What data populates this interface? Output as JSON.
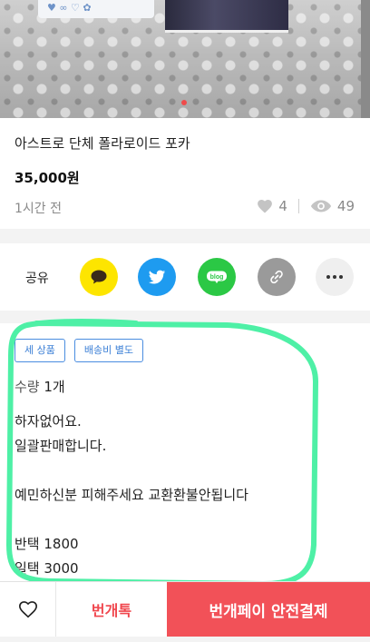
{
  "photo": {
    "card_text": "♥ ∞ ♡  ✿"
  },
  "product": {
    "title": "아스트로 단체 폴라로이드 포카",
    "price": "35,000원",
    "time_ago": "1시간 전",
    "likes": "4",
    "views": "49"
  },
  "share": {
    "label": "공유",
    "buttons": [
      "kakaotalk",
      "twitter",
      "naver-blog",
      "copy-link",
      "more"
    ]
  },
  "tags": [
    "배송비 별도"
  ],
  "tag_partial": "세 상품",
  "quantity": {
    "label": "수량",
    "value": "1개"
  },
  "description": {
    "line1": "하자없어요.",
    "line2": "일괄판매합니다.",
    "line3": "",
    "line4": "예민하신분 피해주세요 교환환불안됩니다",
    "line5": "",
    "line6": "반택 1800",
    "line7": "일택 3000"
  },
  "bottom_bar": {
    "chat_label": "번개톡",
    "pay_label": "번개페이 안전결제"
  },
  "colors": {
    "accent": "#f25158",
    "annotation": "#4ef0a6",
    "tag": "#3b7fd6"
  }
}
